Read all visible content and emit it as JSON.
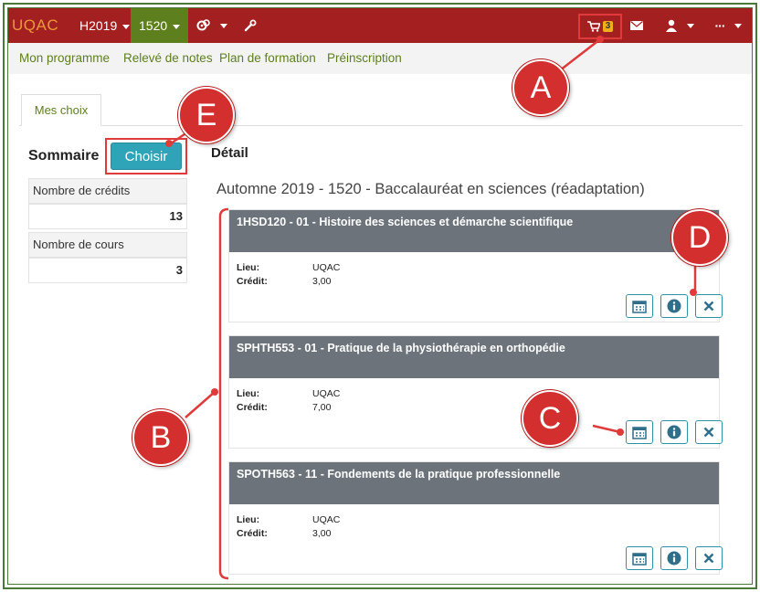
{
  "navbar": {
    "brand": "UQAC",
    "session": "H2019",
    "program": "1520",
    "cart_count": "3",
    "more": "···"
  },
  "subnav": {
    "items": [
      "Mon programme",
      "Relevé de notes",
      "Plan de formation",
      "Préinscription"
    ]
  },
  "tab": {
    "label": "Mes choix"
  },
  "summary": {
    "title": "Sommaire",
    "choose_button": "Choisir",
    "credits_label": "Nombre de crédits",
    "credits_value": "13",
    "courses_label": "Nombre de cours",
    "courses_value": "3"
  },
  "detail": {
    "title": "Détail",
    "program_title": "Automne 2019 - 1520 - Baccalauréat en sciences (réadaptation)",
    "lieu_label": "Lieu:",
    "credit_label": "Crédit:",
    "courses": [
      {
        "name": "1HSD120 - 01 - Histoire des sciences et démarche scientifique",
        "lieu": "UQAC",
        "credit": "3,00"
      },
      {
        "name": "SPHTH553 - 01 - Pratique de la physiothérapie en orthopédie",
        "lieu": "UQAC",
        "credit": "7,00"
      },
      {
        "name": "SPOTH563 - 11 - Fondements de la pratique professionnelle",
        "lieu": "UQAC",
        "credit": "3,00"
      }
    ]
  },
  "annotations": {
    "a": "A",
    "b": "B",
    "c": "C",
    "d": "D",
    "e": "E"
  },
  "colors": {
    "navbar": "#a41f1f",
    "accent_green": "#5d7f1e",
    "button_teal": "#2fa3b8",
    "callout_red": "#d32f2f",
    "card_header": "#6c737b"
  }
}
